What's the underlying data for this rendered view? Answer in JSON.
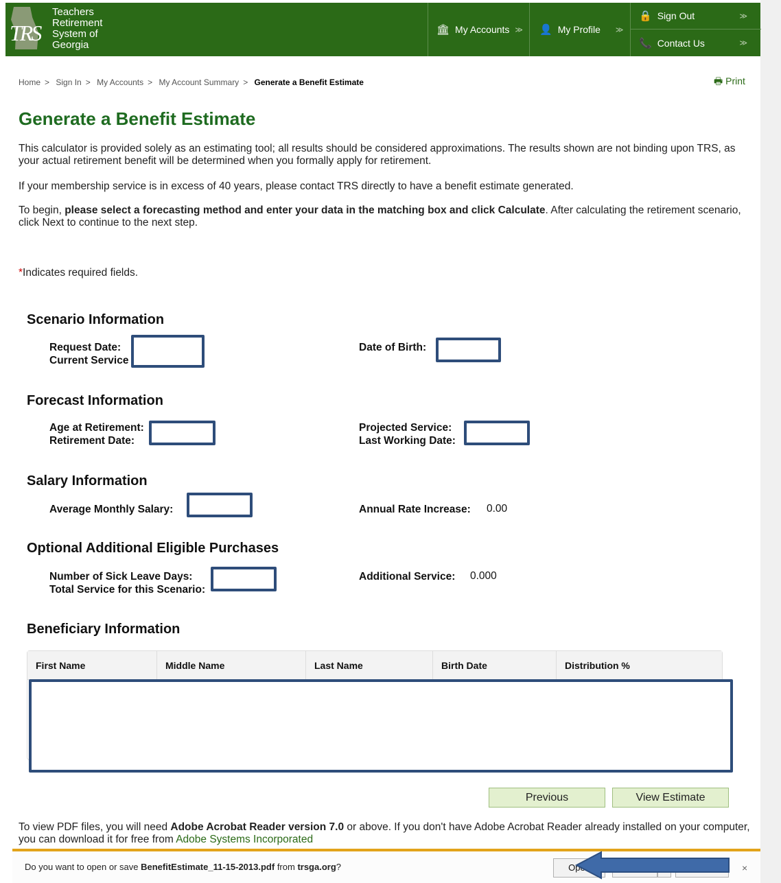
{
  "header": {
    "logo_abbrev": "TRS",
    "logo_lines": [
      "Teachers",
      "Retirement",
      "System of",
      "Georgia"
    ],
    "nav": {
      "accounts": "My Accounts",
      "profile": "My Profile",
      "sign_out": "Sign Out",
      "contact": "Contact Us"
    }
  },
  "breadcrumb": [
    "Home",
    "Sign In",
    "My Accounts",
    "My Account Summary",
    "Generate a Benefit Estimate"
  ],
  "print_label": "Print",
  "title": "Generate a Benefit Estimate",
  "intro": {
    "p1": "This calculator is provided solely as an estimating tool; all results should be considered approximations. The results shown are not binding upon TRS, as your actual retirement benefit will be determined when you formally apply for retirement.",
    "p2": "If your membership service is in excess of 40 years, please contact TRS directly to have a benefit estimate generated.",
    "p3_start": "To begin, ",
    "p3_bold": "please select a forecasting method and enter your data in the matching box and click Calculate",
    "p3_end": ". After calculating the retirement scenario, click Next to continue to the next step."
  },
  "required_note": {
    "star": "*",
    "text": "Indicates required fields."
  },
  "scenario": {
    "heading": "Scenario Information",
    "request_date": "Request Date:",
    "current_service": "Current Service",
    "date_of_birth": "Date of Birth:"
  },
  "forecast": {
    "heading": "Forecast Information",
    "age_at_retirement": "Age at Retirement:",
    "retirement_date": "Retirement Date:",
    "projected_service": "Projected Service:",
    "last_working_date": "Last Working Date:"
  },
  "salary": {
    "heading": "Salary Information",
    "avg_monthly_salary": "Average Monthly Salary:",
    "annual_rate_increase": "Annual Rate Increase:",
    "annual_rate_increase_value": "0.00"
  },
  "purchases": {
    "heading": "Optional Additional Eligible Purchases",
    "sick_leave_days": "Number of Sick Leave Days:",
    "total_service": "Total Service for this Scenario:",
    "additional_service": "Additional Service:",
    "additional_service_value": "0.000"
  },
  "beneficiary": {
    "heading": "Beneficiary Information",
    "columns": [
      "First Name",
      "Middle Name",
      "Last Name",
      "Birth Date",
      "Distribution %"
    ]
  },
  "buttons": {
    "previous": "Previous",
    "view_estimate": "View Estimate"
  },
  "pdf_note": {
    "t1": "To view PDF files, you will need ",
    "b1": "Adobe Acrobat Reader version 7.0",
    "t2": " or above. If you don't have Adobe Acrobat Reader already installed on your computer, you can download it for free from ",
    "link": "Adobe Systems Incorporated"
  },
  "download_bar": {
    "t1": "Do you want to open or save ",
    "filename": "BenefitEstimate_11-15-2013.pdf",
    "t2": " from ",
    "site": "trsga.org",
    "t3": "?",
    "open": "Open",
    "close": "×"
  },
  "colors": {
    "header_green": "#2b6a17",
    "title_green": "#1e6b20",
    "button_bg": "#e3f0cf",
    "redaction_border": "#2e4d7a",
    "download_accent": "#e2a31a"
  }
}
